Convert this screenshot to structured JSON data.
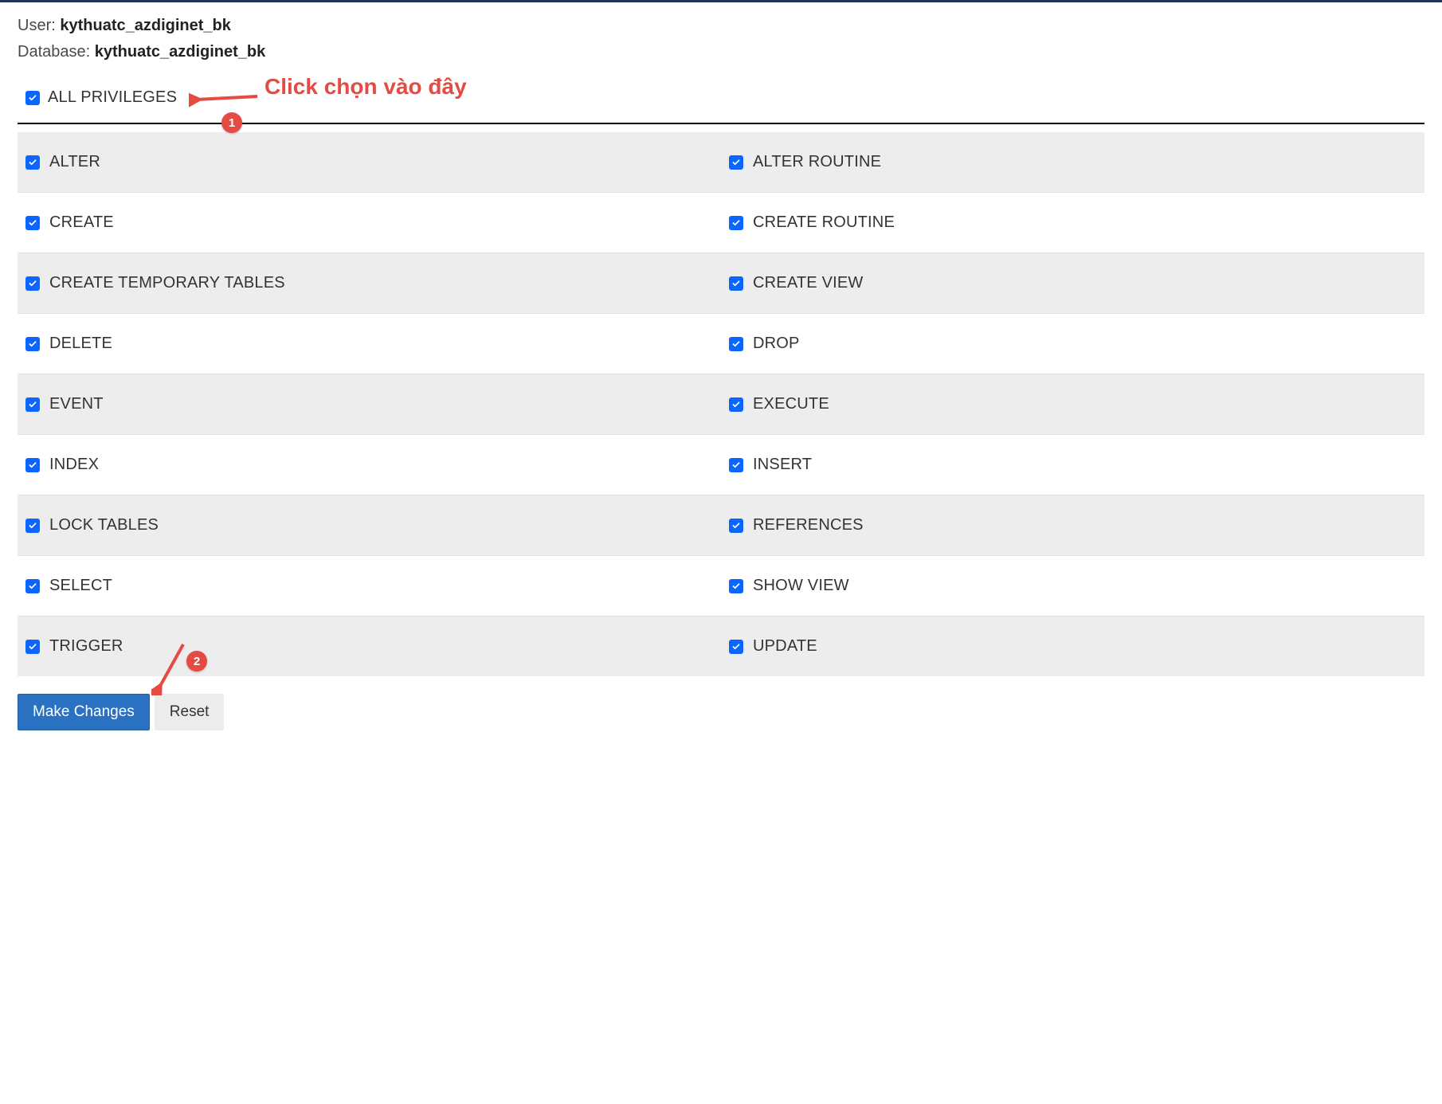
{
  "header": {
    "user_label": "User:",
    "user_value": "kythuatc_azdiginet_bk",
    "db_label": "Database:",
    "db_value": "kythuatc_azdiginet_bk"
  },
  "all_privileges": {
    "label": "ALL PRIVILEGES",
    "checked": true
  },
  "annotations": {
    "hint_text": "Click chọn vào đây",
    "badge1": "1",
    "badge2": "2"
  },
  "privileges": [
    {
      "left": "ALTER",
      "right": "ALTER ROUTINE"
    },
    {
      "left": "CREATE",
      "right": "CREATE ROUTINE"
    },
    {
      "left": "CREATE TEMPORARY TABLES",
      "right": "CREATE VIEW"
    },
    {
      "left": "DELETE",
      "right": "DROP"
    },
    {
      "left": "EVENT",
      "right": "EXECUTE"
    },
    {
      "left": "INDEX",
      "right": "INSERT"
    },
    {
      "left": "LOCK TABLES",
      "right": "REFERENCES"
    },
    {
      "left": "SELECT",
      "right": "SHOW VIEW"
    },
    {
      "left": "TRIGGER",
      "right": "UPDATE"
    }
  ],
  "actions": {
    "make_changes": "Make Changes",
    "reset": "Reset"
  }
}
